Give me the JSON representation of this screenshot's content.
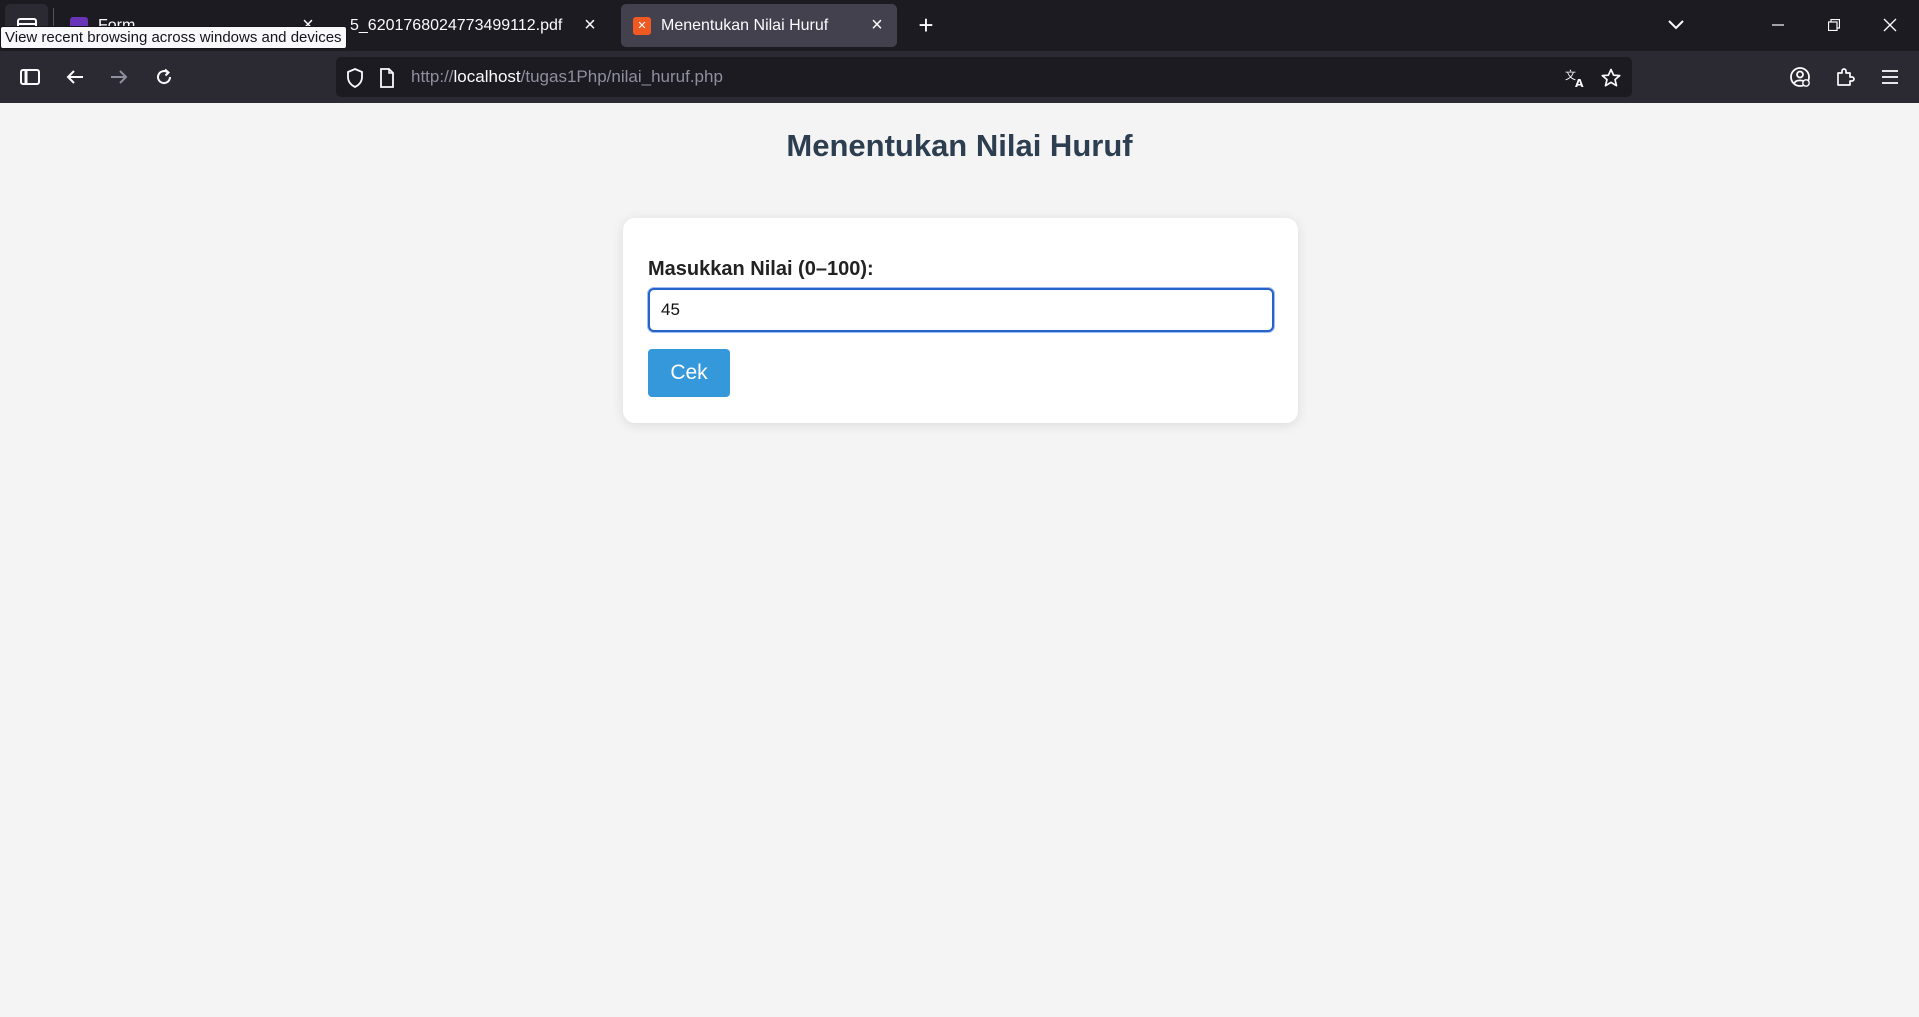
{
  "browser": {
    "tooltip": "View recent browsing across windows and devices",
    "tabs": [
      {
        "label": "Form...",
        "favicon_color": "#6a34b8",
        "active": false
      },
      {
        "label": "5_6201768024773499112.pdf",
        "active": false
      },
      {
        "label": "Menentukan Nilai Huruf",
        "favicon_color": "#f05a22",
        "active": true
      }
    ],
    "url": {
      "scheme": "http://",
      "host": "localhost",
      "path": "/tugas1Php/nilai_huruf.php"
    }
  },
  "page": {
    "title": "Menentukan Nilai Huruf",
    "form": {
      "label": "Masukkan Nilai (0–100):",
      "input_value": "45",
      "submit_label": "Cek"
    }
  },
  "colors": {
    "title": "#2c3e50",
    "button": "#3498db",
    "input_focus": "#2563c9",
    "page_bg": "#f4f4f4"
  }
}
